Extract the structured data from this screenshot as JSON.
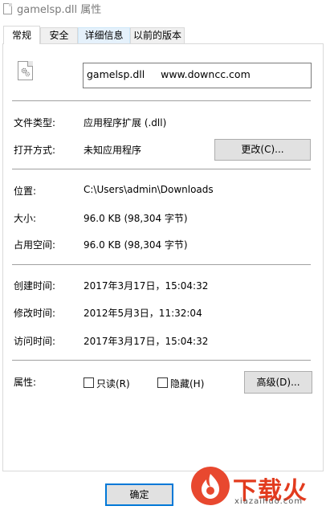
{
  "window": {
    "title": "gamelsp.dll 属性"
  },
  "tabs": [
    {
      "label": "常规",
      "active": true
    },
    {
      "label": "安全",
      "active": false
    },
    {
      "label": "详细信息",
      "active": false
    },
    {
      "label": "以前的版本",
      "active": false
    }
  ],
  "general": {
    "file_icon": "dll-file-icon",
    "filename": "gamelsp.dll     www.downcc.com",
    "type_label": "文件类型:",
    "type_value": "应用程序扩展 (.dll)",
    "open_label": "打开方式:",
    "open_value": "未知应用程序",
    "change_button": "更改(C)...",
    "location_label": "位置:",
    "location_value": "C:\\Users\\admin\\Downloads",
    "size_label": "大小:",
    "size_value": "96.0 KB (98,304 字节)",
    "disk_label": "占用空间:",
    "disk_value": "96.0 KB (98,304 字节)",
    "created_label": "创建时间:",
    "created_value": "2017年3月17日，15:04:32",
    "modified_label": "修改时间:",
    "modified_value": "2012年5月3日，11:32:04",
    "accessed_label": "访问时间:",
    "accessed_value": "2017年3月17日，15:04:32",
    "attr_label": "属性:",
    "readonly_label": "只读(R)",
    "readonly_checked": false,
    "hidden_label": "隐藏(H)",
    "hidden_checked": false,
    "advanced_button": "高级(D)..."
  },
  "footer": {
    "ok_button": "确定"
  },
  "watermark": {
    "brand": "下载火",
    "domain": "xiazaihuo.com",
    "badge_color": "#e8482f",
    "text_color": "#e23b1e"
  }
}
